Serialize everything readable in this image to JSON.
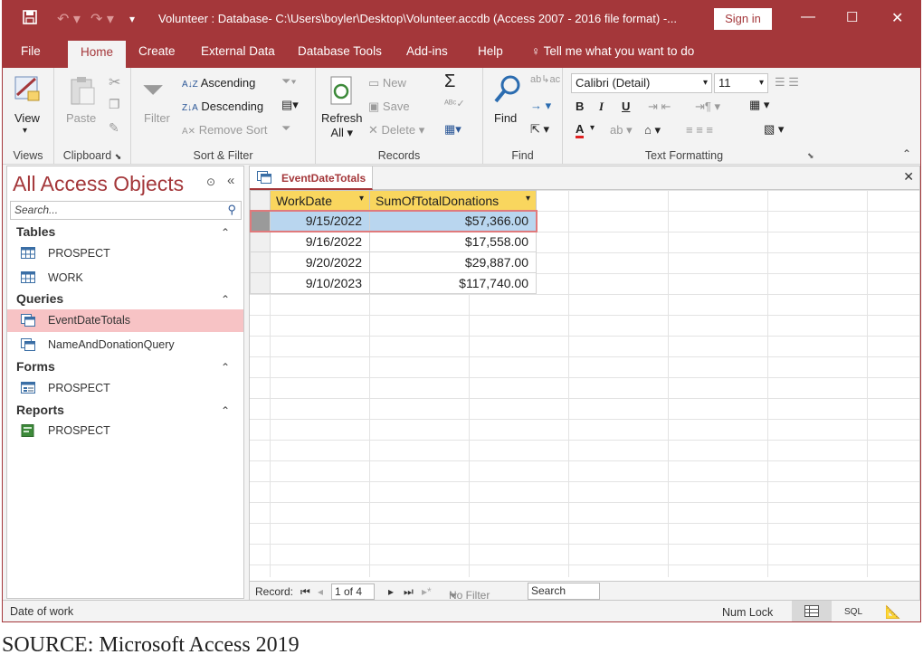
{
  "window": {
    "title": "Volunteer : Database- C:\\Users\\boyler\\Desktop\\Volunteer.accdb (Access 2007 - 2016 file format) -...",
    "sign_in": "Sign in",
    "minimize": "—",
    "maximize": "☐",
    "close": "✕"
  },
  "tabs": [
    "File",
    "Home",
    "Create",
    "External Data",
    "Database Tools",
    "Add-ins",
    "Help"
  ],
  "tell_me": "Tell me what you want to do",
  "ribbon": {
    "views": {
      "view": "View",
      "label": "Views"
    },
    "clipboard": {
      "paste": "Paste",
      "label": "Clipboard"
    },
    "sort_filter": {
      "filter": "Filter",
      "ascending": "Ascending",
      "descending": "Descending",
      "remove_sort": "Remove Sort",
      "label": "Sort & Filter"
    },
    "records": {
      "refresh": "Refresh",
      "refresh_all": "All",
      "new": "New",
      "save": "Save",
      "delete": "Delete",
      "label": "Records"
    },
    "find": {
      "find": "Find",
      "label": "Find"
    },
    "text_formatting": {
      "font": "Calibri (Detail)",
      "size": "11",
      "bold": "B",
      "italic": "I",
      "underline": "U",
      "label": "Text Formatting"
    }
  },
  "nav": {
    "title": "All Access Objects",
    "search_placeholder": "Search...",
    "sections": [
      {
        "name": "Tables",
        "items": [
          "PROSPECT",
          "WORK"
        ]
      },
      {
        "name": "Queries",
        "items": [
          "EventDateTotals",
          "NameAndDonationQuery"
        ]
      },
      {
        "name": "Forms",
        "items": [
          "PROSPECT"
        ]
      },
      {
        "name": "Reports",
        "items": [
          "PROSPECT"
        ]
      }
    ]
  },
  "document": {
    "tab": "EventDateTotals",
    "columns": [
      "WorkDate",
      "SumOfTotalDonations"
    ],
    "rows": [
      [
        "9/15/2022",
        "$57,366.00"
      ],
      [
        "9/16/2022",
        "$17,558.00"
      ],
      [
        "9/20/2022",
        "$29,887.00"
      ],
      [
        "9/10/2023",
        "$117,740.00"
      ]
    ]
  },
  "record_nav": {
    "label": "Record:",
    "position": "1 of 4",
    "no_filter": "No Filter",
    "search": "Search"
  },
  "status": {
    "left": "Date of work",
    "num_lock": "Num Lock",
    "sql": "SQL"
  },
  "caption": "SOURCE: Microsoft Access 2019",
  "colors": {
    "accent": "#a4373a",
    "header": "#f9d65e",
    "selection": "#b9d6ef",
    "nav_selected": "#f7c3c5"
  }
}
